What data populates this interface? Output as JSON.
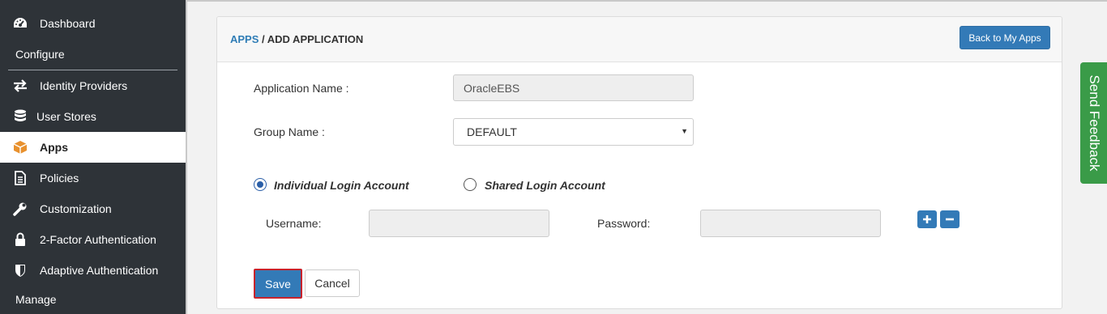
{
  "sidebar": {
    "items": [
      {
        "label": "Dashboard",
        "icon": "dashboard-icon"
      },
      {
        "label": "Identity Providers",
        "icon": "arrows-exchange-icon"
      },
      {
        "label": "User Stores",
        "icon": "database-icon"
      },
      {
        "label": "Apps",
        "icon": "cube-icon",
        "active": true
      },
      {
        "label": "Policies",
        "icon": "document-icon"
      },
      {
        "label": "Customization",
        "icon": "wrench-icon"
      },
      {
        "label": "2-Factor Authentication",
        "icon": "lock-icon"
      },
      {
        "label": "Adaptive Authentication",
        "icon": "shield-icon"
      }
    ],
    "sections": {
      "configure": "Configure",
      "manage": "Manage"
    }
  },
  "header": {
    "breadcrumb_link": "APPS",
    "breadcrumb_separator": " / ",
    "breadcrumb_current": "ADD APPLICATION",
    "back_button": "Back to My Apps"
  },
  "form": {
    "app_name_label": "Application Name :",
    "app_name_value": "OracleEBS",
    "group_name_label": "Group Name :",
    "group_name_value": "DEFAULT",
    "individual_login_label": "Individual Login Account",
    "shared_login_label": "Shared Login Account",
    "username_label": "Username:",
    "username_value": "",
    "password_label": "Password:",
    "password_value": "",
    "save_label": "Save",
    "cancel_label": "Cancel"
  },
  "feedback": {
    "label": "Send Feedback"
  },
  "colors": {
    "sidebar_bg": "#2e3338",
    "primary": "#337ab7",
    "feedback": "#3a9b48",
    "active_accent": "#e8912e"
  }
}
